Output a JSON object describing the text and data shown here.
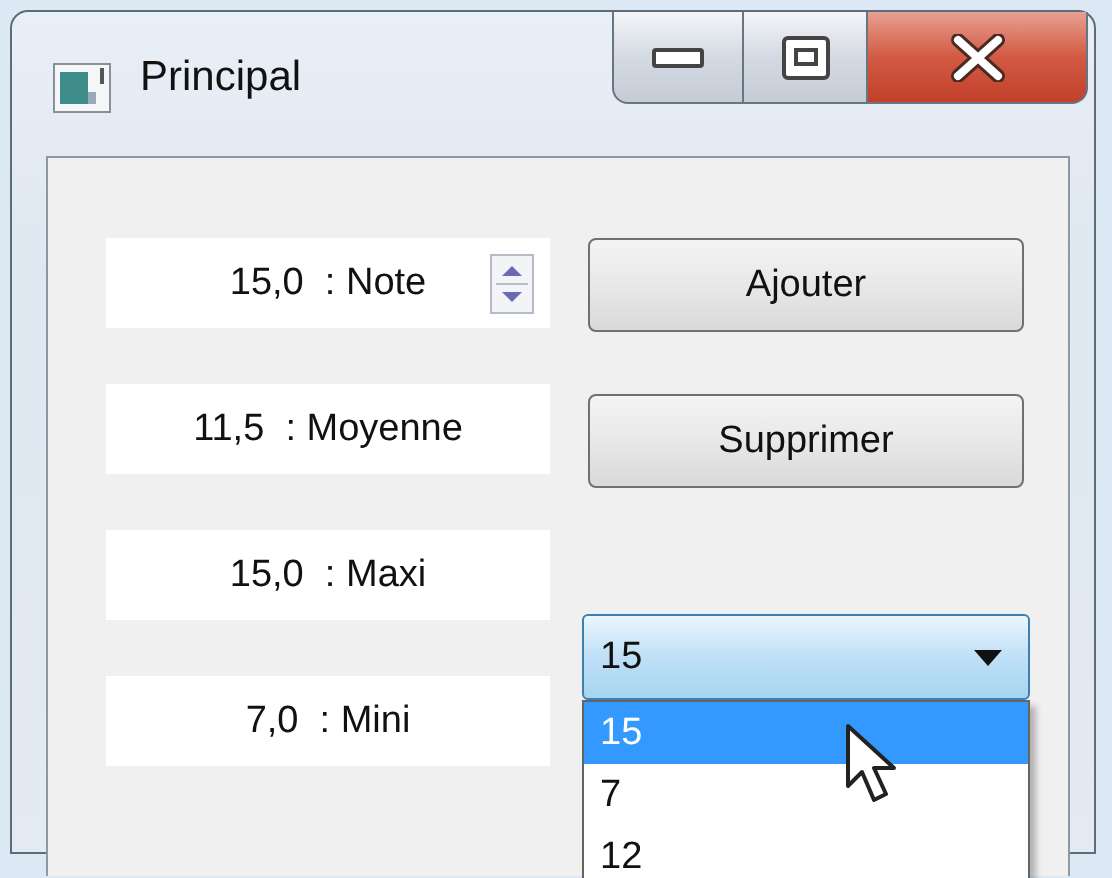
{
  "window": {
    "title": "Principal"
  },
  "fields": [
    {
      "kind": "spin",
      "text": "15,0  : Note"
    },
    {
      "kind": "plain",
      "text": "11,5  : Moyenne"
    },
    {
      "kind": "plain",
      "text": "15,0  : Maxi"
    },
    {
      "kind": "plain",
      "text": "7,0  : Mini"
    }
  ],
  "buttons": [
    "Ajouter",
    "Supprimer"
  ],
  "combo": {
    "value": "15",
    "expanded": true,
    "options": [
      {
        "label": "15",
        "selected": true
      },
      {
        "label": "7",
        "selected": false
      },
      {
        "label": "12",
        "selected": false
      }
    ]
  }
}
